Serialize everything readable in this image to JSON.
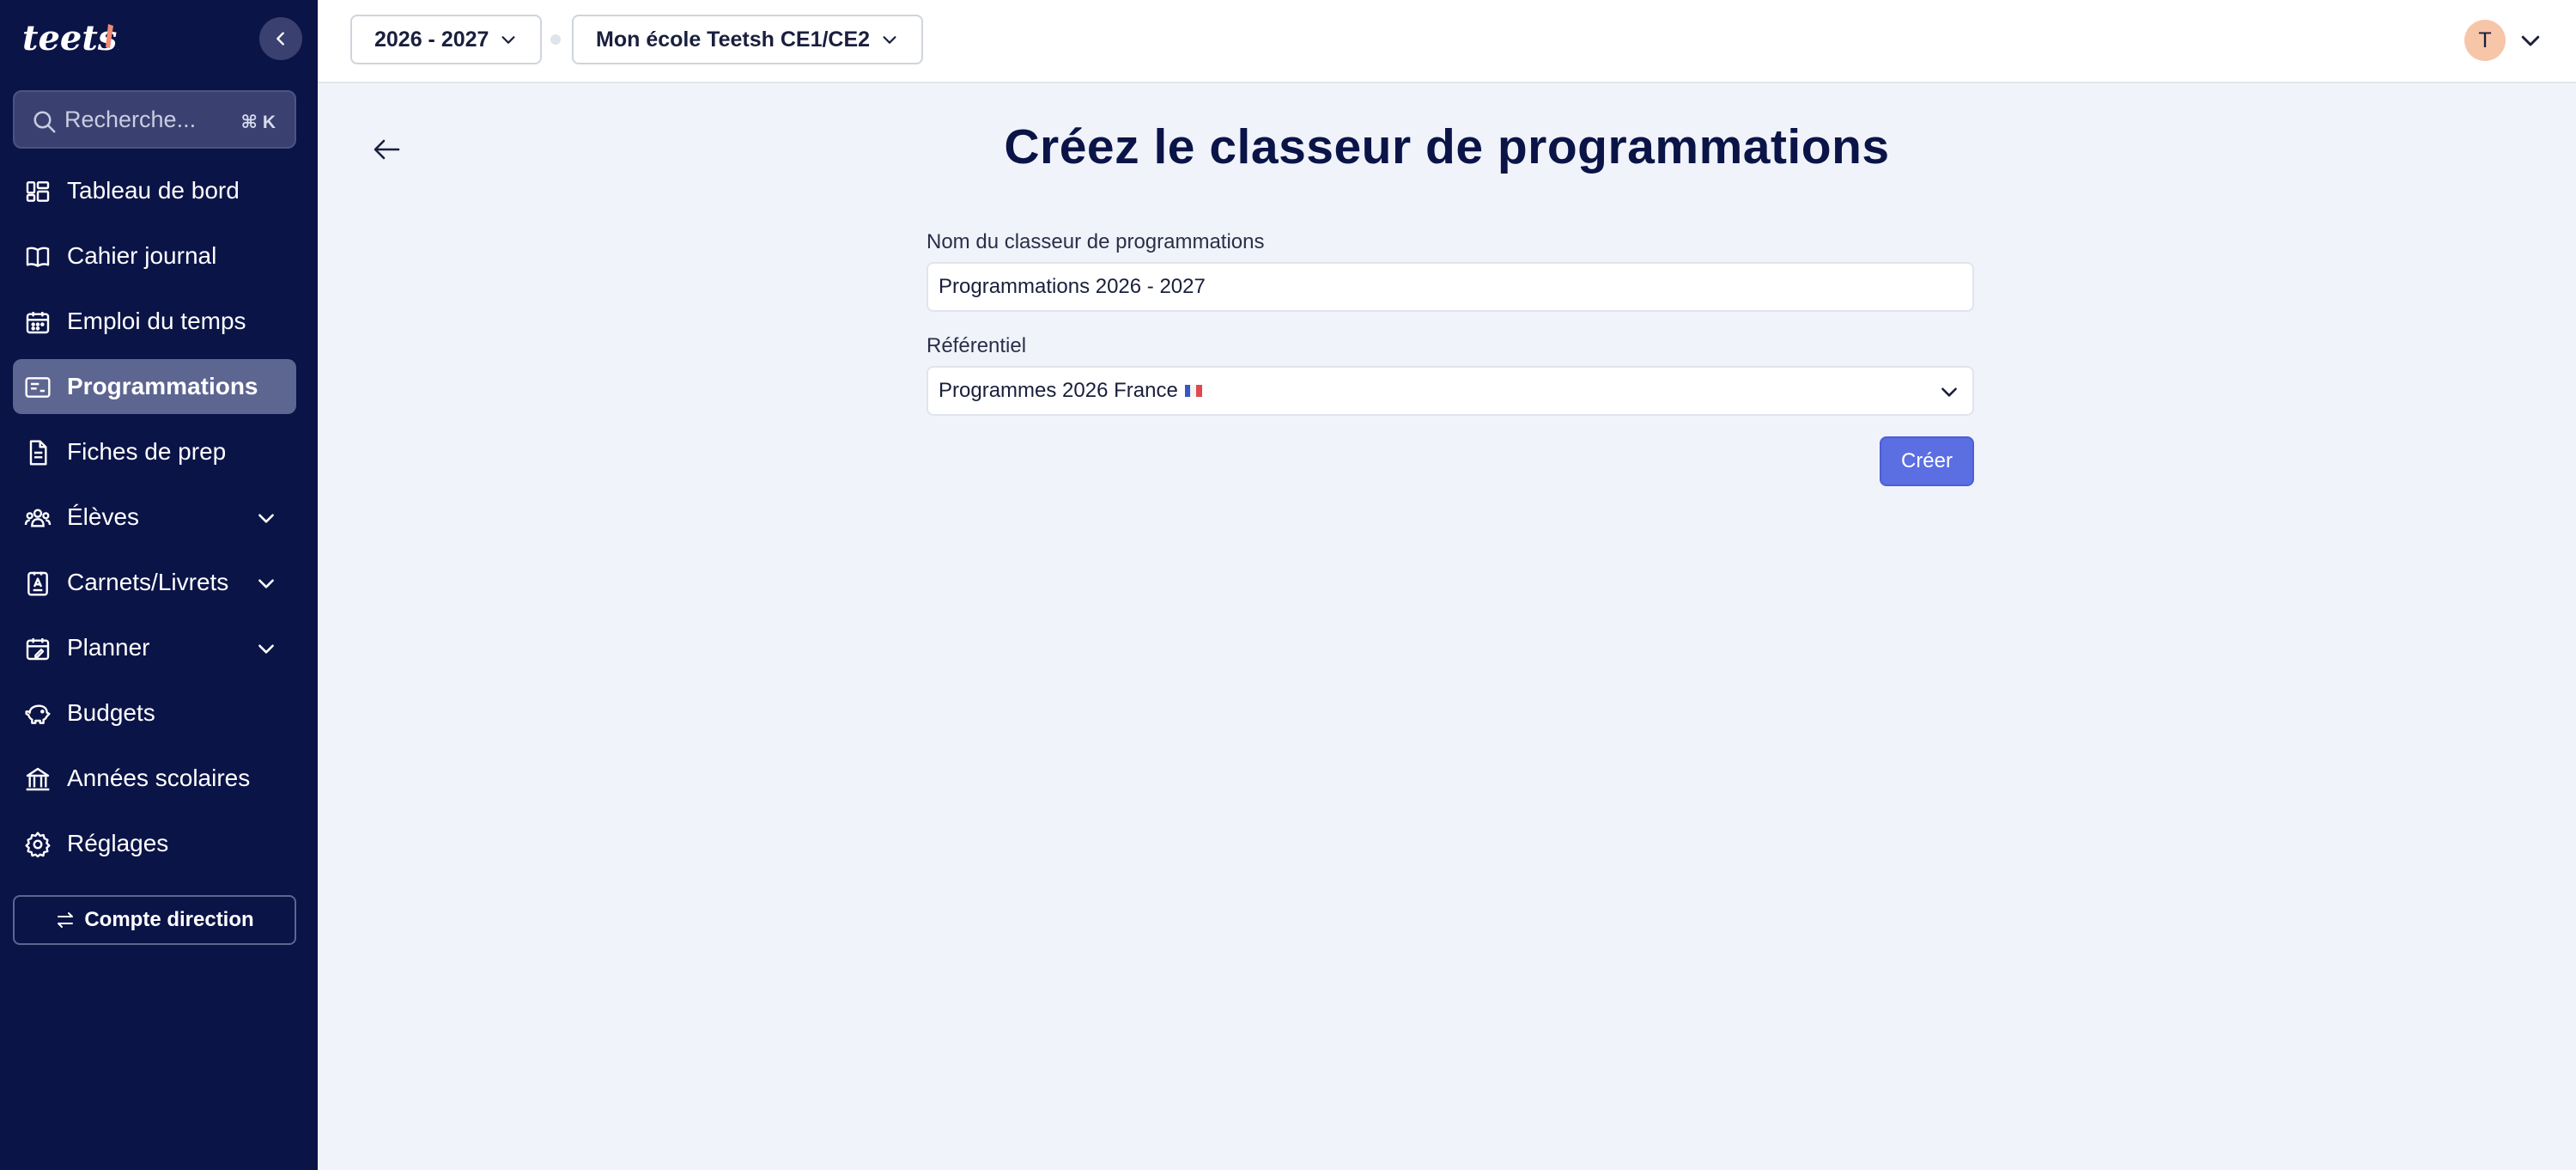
{
  "app": {
    "brand": "teetsh"
  },
  "sidebar": {
    "search": {
      "placeholder": "Recherche...",
      "shortcut": "⌘ K"
    },
    "items": [
      {
        "label": "Tableau de bord",
        "icon": "dashboard-icon"
      },
      {
        "label": "Cahier journal",
        "icon": "book-icon"
      },
      {
        "label": "Emploi du temps",
        "icon": "calendar-icon"
      },
      {
        "label": "Programmations",
        "icon": "programmations-icon",
        "active": true
      },
      {
        "label": "Fiches de prep",
        "icon": "document-icon"
      },
      {
        "label": "Élèves",
        "icon": "students-icon",
        "expandable": true
      },
      {
        "label": "Carnets/Livrets",
        "icon": "notebook-icon",
        "expandable": true
      },
      {
        "label": "Planner",
        "icon": "planner-icon",
        "expandable": true
      },
      {
        "label": "Budgets",
        "icon": "piggy-bank-icon"
      },
      {
        "label": "Années scolaires",
        "icon": "institution-icon"
      },
      {
        "label": "Réglages",
        "icon": "gear-icon"
      }
    ],
    "direction_button": "Compte direction"
  },
  "topbar": {
    "year_selector": "2026 - 2027",
    "school_selector": "Mon école Teetsh CE1/CE2",
    "avatar_initial": "T"
  },
  "main": {
    "title": "Créez le classeur de programmations",
    "name_field": {
      "label": "Nom du classeur de programmations",
      "value": "Programmations 2026 - 2027"
    },
    "referential_field": {
      "label": "Référentiel",
      "value": "Programmes 2026 France"
    },
    "create_button": "Créer"
  },
  "colors": {
    "sidebar_bg": "#0b1447",
    "active_item_bg": "#5d6591",
    "main_bg": "#f0f3fa",
    "primary_button": "#5b6fe3",
    "avatar_bg": "#f7c5a8"
  }
}
